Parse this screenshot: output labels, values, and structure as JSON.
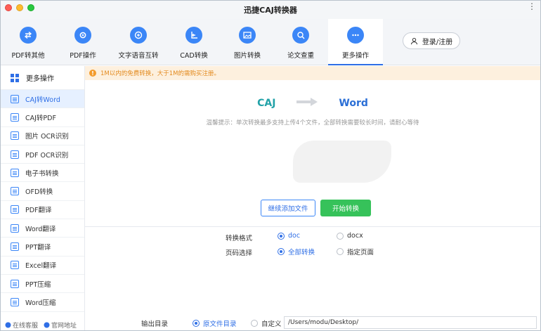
{
  "window": {
    "title": "迅捷CAJ转换器"
  },
  "toolbar": {
    "tabs": [
      {
        "label": "PDF转其他",
        "icon": "swap-icon"
      },
      {
        "label": "PDF操作",
        "icon": "gear-icon"
      },
      {
        "label": "文字语音互转",
        "icon": "audio-text-icon"
      },
      {
        "label": "CAD转换",
        "icon": "cad-icon"
      },
      {
        "label": "图片转换",
        "icon": "image-icon"
      },
      {
        "label": "论文查重",
        "icon": "search-doc-icon"
      },
      {
        "label": "更多操作",
        "icon": "more-icon",
        "active": true
      }
    ],
    "login_label": "登录/注册"
  },
  "sidebar": {
    "header": "更多操作",
    "items": [
      {
        "label": "CAJ转Word",
        "active": true
      },
      {
        "label": "CAJ转PDF"
      },
      {
        "label": "图片 OCR识别"
      },
      {
        "label": "PDF OCR识别"
      },
      {
        "label": "电子书转换"
      },
      {
        "label": "OFD转换"
      },
      {
        "label": "PDF翻译"
      },
      {
        "label": "Word翻译"
      },
      {
        "label": "PPT翻译"
      },
      {
        "label": "Excel翻译"
      },
      {
        "label": "PPT压缩"
      },
      {
        "label": "Word压缩"
      }
    ],
    "footer": {
      "support": "在线客服",
      "website": "官网地址"
    }
  },
  "notice": {
    "text": "1M以内的免费转换，大于1M的需购买注册。"
  },
  "main": {
    "from_format": "CAJ",
    "to_format": "Word",
    "hint": "温馨提示：单次转换最多支持上传4个文件，全部转换需要较长时间，请耐心等待",
    "add_files_label": "继续添加文件",
    "start_label": "开始转换",
    "format": {
      "label": "转换格式",
      "options": [
        "doc",
        "docx"
      ],
      "selected": "doc"
    },
    "pages": {
      "label": "页码选择",
      "options": [
        "全部转换",
        "指定页面"
      ],
      "selected": "全部转换"
    },
    "output": {
      "label": "输出目录",
      "options": [
        "原文件目录",
        "自定义"
      ],
      "selected": "原文件目录",
      "path": "/Users/modu/Desktop/"
    }
  },
  "colors": {
    "accent": "#2f6fe6",
    "start_button": "#36c25a",
    "notice_bg": "#fdf0de",
    "notice_text": "#e38a1e",
    "caj": "#22a2a8",
    "word": "#2b6fd6"
  }
}
